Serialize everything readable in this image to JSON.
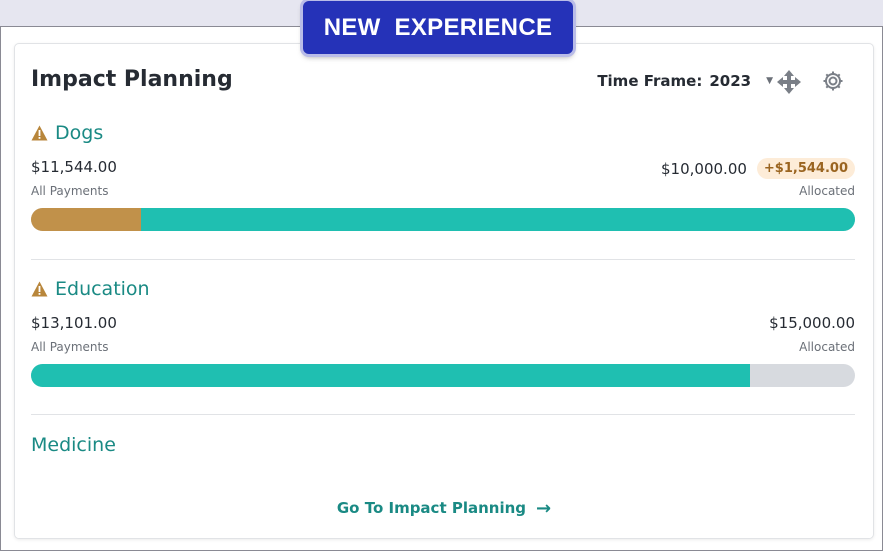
{
  "banner": {
    "text": "NEW  EXPERIENCE"
  },
  "widget": {
    "title": "Impact Planning",
    "time_frame_label": "Time Frame:",
    "time_frame_value": "2023"
  },
  "categories": [
    {
      "name": "Dogs",
      "warning": true,
      "all_payments_amount": "$11,544.00",
      "all_payments_label": "All Payments",
      "allocated_amount": "$10,000.00",
      "allocated_label": "Allocated",
      "over_badge": "+$1,544.00",
      "progress": {
        "over_fraction": 0.134,
        "main_fraction": 0.866
      }
    },
    {
      "name": "Education",
      "warning": true,
      "all_payments_amount": "$13,101.00",
      "all_payments_label": "All Payments",
      "allocated_amount": "$15,000.00",
      "allocated_label": "Allocated",
      "progress": {
        "fraction": 0.873
      }
    },
    {
      "name": "Medicine",
      "warning": false
    }
  ],
  "footer": {
    "link_label": "Go To Impact Planning"
  },
  "colors": {
    "accent_teal": "#1fbfb1",
    "overspend_gold": "#c1914a",
    "track_gray": "#d7dadf",
    "heading_teal": "#1a8a84",
    "warning_gold": "#b8863b",
    "banner_blue": "#2532b8"
  },
  "icons": {
    "move": "move-arrows-icon",
    "settings": "gear-icon",
    "warning": "warning-triangle-icon",
    "footer_arrow": "arrow-right-icon"
  }
}
